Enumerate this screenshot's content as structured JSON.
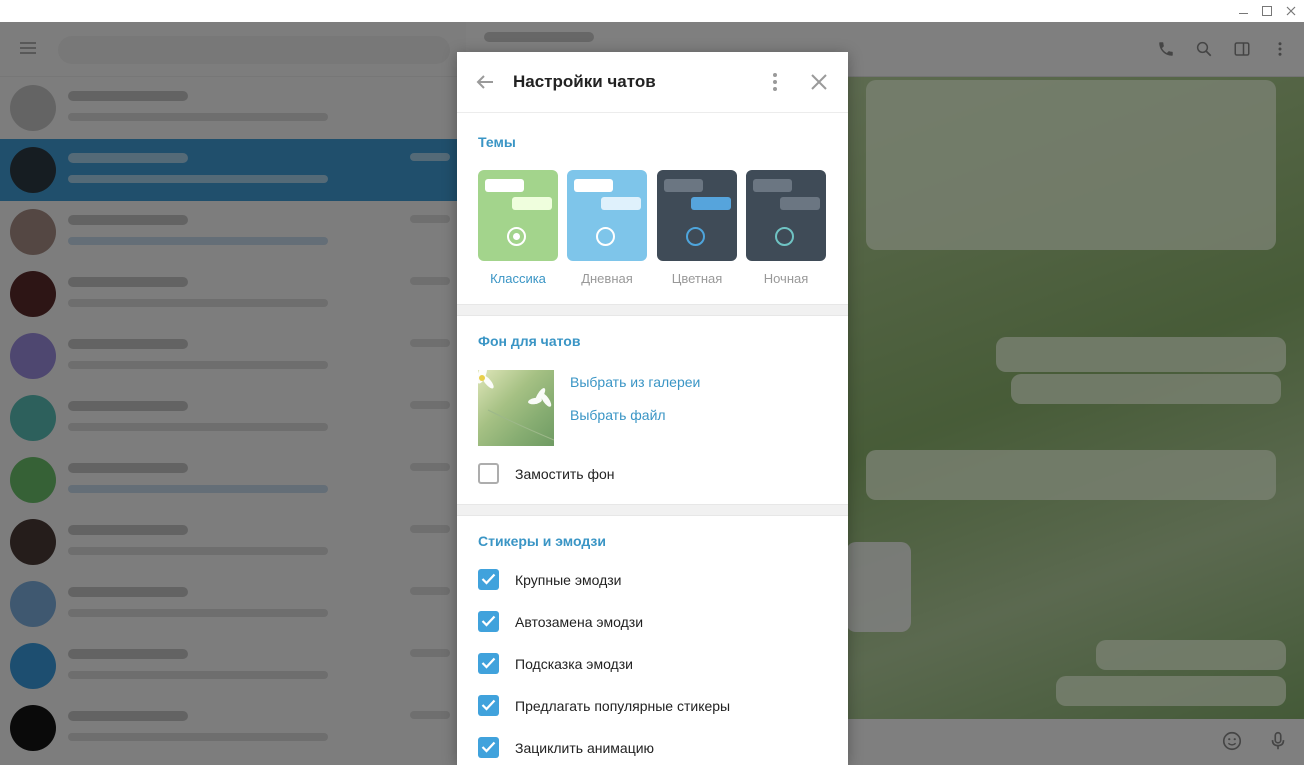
{
  "window": {
    "minimize_icon": "minimize-icon",
    "maximize_icon": "maximize-icon",
    "close_icon": "close-icon"
  },
  "background_app": {
    "header_icons": [
      "phone-icon",
      "search-icon",
      "sidebar-icon",
      "more-vertical-icon"
    ],
    "footer_icons": [
      "emoji-icon",
      "microphone-icon"
    ],
    "accent_color": "#419fd9"
  },
  "dialog": {
    "title": "Настройки чатов",
    "back_icon": "arrow-left-icon",
    "more_icon": "more-vertical-icon",
    "close_icon": "close-icon",
    "themes": {
      "section_title": "Темы",
      "items": [
        {
          "label": "Классика",
          "selected": true,
          "bg": "#a3d48c",
          "bubble1": "#ffffff",
          "bubble2": "#effedd",
          "radio_color": "#ffffff"
        },
        {
          "label": "Дневная",
          "selected": false,
          "bg": "#7ec5ea",
          "bubble1": "#ffffff",
          "bubble2": "#dff1fc",
          "radio_color": "#ffffff"
        },
        {
          "label": "Цветная",
          "selected": false,
          "bg": "#3f4b57",
          "bubble1": "#6b7682",
          "bubble2": "#56a4dc",
          "radio_color": "#4ea5dc"
        },
        {
          "label": "Ночная",
          "selected": false,
          "bg": "#3f4b57",
          "bubble1": "#6b7682",
          "bubble2": "#6b7682",
          "radio_color": "#6fc3c3"
        }
      ]
    },
    "chat_background": {
      "section_title": "Фон для чатов",
      "choose_gallery": "Выбрать из галереи",
      "choose_file": "Выбрать файл",
      "tile_label": "Замостить фон",
      "tile_checked": false
    },
    "stickers": {
      "section_title": "Стикеры и эмодзи",
      "options": [
        {
          "label": "Крупные эмодзи",
          "checked": true
        },
        {
          "label": "Автозамена эмодзи",
          "checked": true
        },
        {
          "label": "Подсказка эмодзи",
          "checked": true
        },
        {
          "label": "Предлагать популярные стикеры",
          "checked": true
        },
        {
          "label": "Зациклить анимацию",
          "checked": true
        }
      ]
    }
  }
}
